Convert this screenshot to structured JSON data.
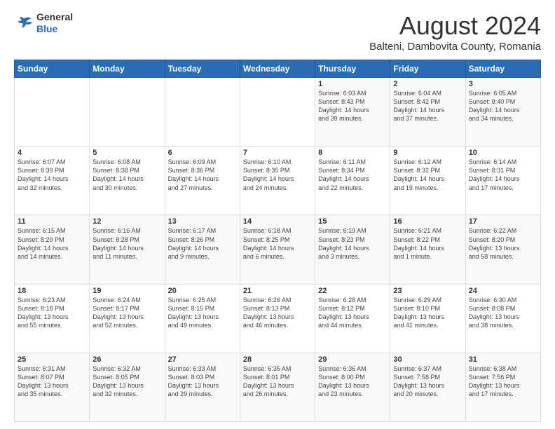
{
  "header": {
    "logo_line1": "General",
    "logo_line2": "Blue",
    "month": "August 2024",
    "location": "Balteni, Dambovita County, Romania"
  },
  "days_of_week": [
    "Sunday",
    "Monday",
    "Tuesday",
    "Wednesday",
    "Thursday",
    "Friday",
    "Saturday"
  ],
  "weeks": [
    [
      {
        "day": "",
        "info": ""
      },
      {
        "day": "",
        "info": ""
      },
      {
        "day": "",
        "info": ""
      },
      {
        "day": "",
        "info": ""
      },
      {
        "day": "1",
        "info": "Sunrise: 6:03 AM\nSunset: 8:43 PM\nDaylight: 14 hours\nand 39 minutes."
      },
      {
        "day": "2",
        "info": "Sunrise: 6:04 AM\nSunset: 8:42 PM\nDaylight: 14 hours\nand 37 minutes."
      },
      {
        "day": "3",
        "info": "Sunrise: 6:05 AM\nSunset: 8:40 PM\nDaylight: 14 hours\nand 34 minutes."
      }
    ],
    [
      {
        "day": "4",
        "info": "Sunrise: 6:07 AM\nSunset: 8:39 PM\nDaylight: 14 hours\nand 32 minutes."
      },
      {
        "day": "5",
        "info": "Sunrise: 6:08 AM\nSunset: 8:38 PM\nDaylight: 14 hours\nand 30 minutes."
      },
      {
        "day": "6",
        "info": "Sunrise: 6:09 AM\nSunset: 8:36 PM\nDaylight: 14 hours\nand 27 minutes."
      },
      {
        "day": "7",
        "info": "Sunrise: 6:10 AM\nSunset: 8:35 PM\nDaylight: 14 hours\nand 24 minutes."
      },
      {
        "day": "8",
        "info": "Sunrise: 6:11 AM\nSunset: 8:34 PM\nDaylight: 14 hours\nand 22 minutes."
      },
      {
        "day": "9",
        "info": "Sunrise: 6:12 AM\nSunset: 8:32 PM\nDaylight: 14 hours\nand 19 minutes."
      },
      {
        "day": "10",
        "info": "Sunrise: 6:14 AM\nSunset: 8:31 PM\nDaylight: 14 hours\nand 17 minutes."
      }
    ],
    [
      {
        "day": "11",
        "info": "Sunrise: 6:15 AM\nSunset: 8:29 PM\nDaylight: 14 hours\nand 14 minutes."
      },
      {
        "day": "12",
        "info": "Sunrise: 6:16 AM\nSunset: 8:28 PM\nDaylight: 14 hours\nand 11 minutes."
      },
      {
        "day": "13",
        "info": "Sunrise: 6:17 AM\nSunset: 8:26 PM\nDaylight: 14 hours\nand 9 minutes."
      },
      {
        "day": "14",
        "info": "Sunrise: 6:18 AM\nSunset: 8:25 PM\nDaylight: 14 hours\nand 6 minutes."
      },
      {
        "day": "15",
        "info": "Sunrise: 6:19 AM\nSunset: 8:23 PM\nDaylight: 14 hours\nand 3 minutes."
      },
      {
        "day": "16",
        "info": "Sunrise: 6:21 AM\nSunset: 8:22 PM\nDaylight: 14 hours\nand 1 minute."
      },
      {
        "day": "17",
        "info": "Sunrise: 6:22 AM\nSunset: 8:20 PM\nDaylight: 13 hours\nand 58 minutes."
      }
    ],
    [
      {
        "day": "18",
        "info": "Sunrise: 6:23 AM\nSunset: 8:18 PM\nDaylight: 13 hours\nand 55 minutes."
      },
      {
        "day": "19",
        "info": "Sunrise: 6:24 AM\nSunset: 8:17 PM\nDaylight: 13 hours\nand 52 minutes."
      },
      {
        "day": "20",
        "info": "Sunrise: 6:25 AM\nSunset: 8:15 PM\nDaylight: 13 hours\nand 49 minutes."
      },
      {
        "day": "21",
        "info": "Sunrise: 6:26 AM\nSunset: 8:13 PM\nDaylight: 13 hours\nand 46 minutes."
      },
      {
        "day": "22",
        "info": "Sunrise: 6:28 AM\nSunset: 8:12 PM\nDaylight: 13 hours\nand 44 minutes."
      },
      {
        "day": "23",
        "info": "Sunrise: 6:29 AM\nSunset: 8:10 PM\nDaylight: 13 hours\nand 41 minutes."
      },
      {
        "day": "24",
        "info": "Sunrise: 6:30 AM\nSunset: 8:08 PM\nDaylight: 13 hours\nand 38 minutes."
      }
    ],
    [
      {
        "day": "25",
        "info": "Sunrise: 6:31 AM\nSunset: 8:07 PM\nDaylight: 13 hours\nand 35 minutes."
      },
      {
        "day": "26",
        "info": "Sunrise: 6:32 AM\nSunset: 8:05 PM\nDaylight: 13 hours\nand 32 minutes."
      },
      {
        "day": "27",
        "info": "Sunrise: 6:33 AM\nSunset: 8:03 PM\nDaylight: 13 hours\nand 29 minutes."
      },
      {
        "day": "28",
        "info": "Sunrise: 6:35 AM\nSunset: 8:01 PM\nDaylight: 13 hours\nand 26 minutes."
      },
      {
        "day": "29",
        "info": "Sunrise: 6:36 AM\nSunset: 8:00 PM\nDaylight: 13 hours\nand 23 minutes."
      },
      {
        "day": "30",
        "info": "Sunrise: 6:37 AM\nSunset: 7:58 PM\nDaylight: 13 hours\nand 20 minutes."
      },
      {
        "day": "31",
        "info": "Sunrise: 6:38 AM\nSunset: 7:56 PM\nDaylight: 13 hours\nand 17 minutes."
      }
    ]
  ]
}
